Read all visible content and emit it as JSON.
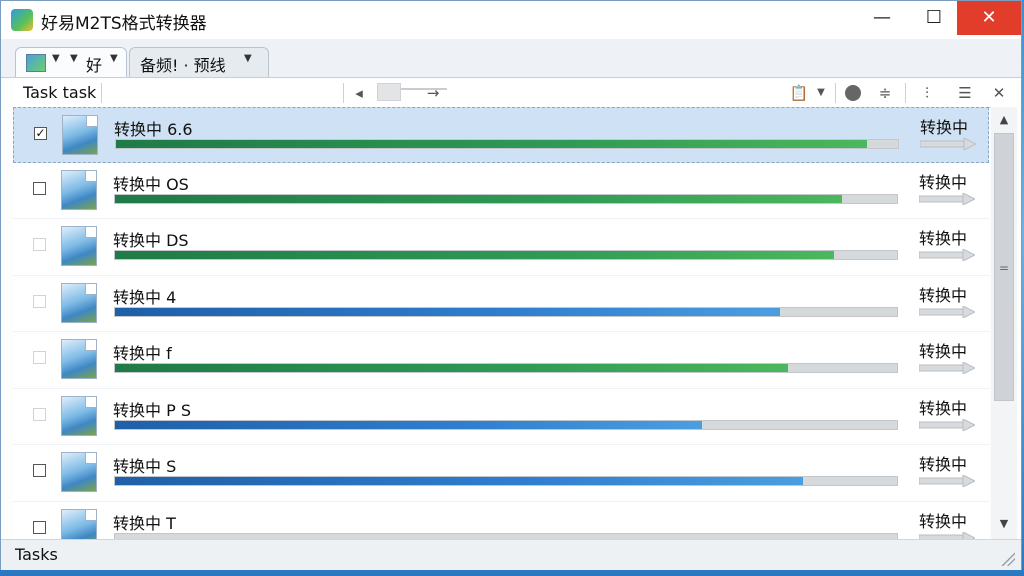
{
  "window": {
    "title": "好易M2TS格式转换器",
    "min_glyph": "—",
    "max_glyph": "☐",
    "close_glyph": "✕"
  },
  "tabs": [
    {
      "label": "好",
      "caret": "▼"
    },
    {
      "label": "备频! · 预线",
      "caret": "▼"
    }
  ],
  "toolbar": {
    "label": "Task task",
    "icons": [
      "slider-left-icon",
      "clipboard-icon",
      "record-icon",
      "filter-icon",
      "columns-icon",
      "align-icon",
      "close-icon"
    ]
  },
  "rows": [
    {
      "name": "转换中 6.6",
      "status": "转换中",
      "progress": 0.96,
      "color": "green",
      "checked": true,
      "selected": true,
      "checkbox_dim": false
    },
    {
      "name": "转换中 OS",
      "status": "转换中",
      "progress": 0.93,
      "color": "green",
      "checked": false,
      "selected": false,
      "checkbox_dim": false
    },
    {
      "name": "转换中 DS",
      "status": "转换中",
      "progress": 0.92,
      "color": "green",
      "checked": false,
      "selected": false,
      "checkbox_dim": true
    },
    {
      "name": "转换中 4",
      "status": "转换中",
      "progress": 0.85,
      "color": "blue",
      "checked": false,
      "selected": false,
      "checkbox_dim": true
    },
    {
      "name": "转换中 f",
      "status": "转换中",
      "progress": 0.86,
      "color": "green",
      "checked": false,
      "selected": false,
      "checkbox_dim": true
    },
    {
      "name": "转换中 P S",
      "status": "转换中",
      "progress": 0.75,
      "color": "blue",
      "checked": false,
      "selected": false,
      "checkbox_dim": true
    },
    {
      "name": "转换中 S",
      "status": "转换中",
      "progress": 0.88,
      "color": "blue",
      "checked": false,
      "selected": false,
      "checkbox_dim": false
    },
    {
      "name": "转换中 T",
      "status": "转换中",
      "progress": 0.0,
      "color": "gray",
      "checked": false,
      "selected": false,
      "checkbox_dim": false
    }
  ],
  "scrollbar": {
    "up": "▲",
    "down": "▼",
    "grip": "="
  },
  "statusbar": {
    "text": "Tasks"
  },
  "colors": {
    "accent": "#2f7fcf",
    "green": "#2f9a55",
    "close": "#e23c2a",
    "selected_row": "#cfe2f5"
  }
}
